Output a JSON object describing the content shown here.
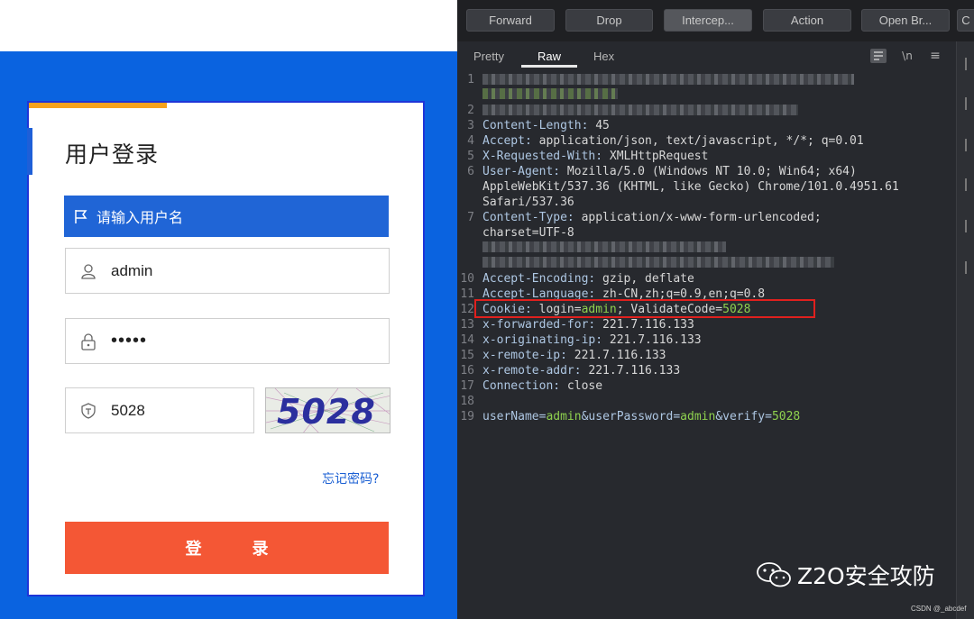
{
  "login": {
    "title": "用户登录",
    "notice": "请输入用户名",
    "username_value": "admin",
    "password_value": "•••••",
    "code_value": "5028",
    "captcha_text": "5028",
    "forgot_link": "忘记密码?",
    "login_button": "登录"
  },
  "toolbar": {
    "forward": "Forward",
    "drop": "Drop",
    "intercept": "Intercep...",
    "action": "Action",
    "open_browser": "Open Br...",
    "more": "C"
  },
  "tabs": {
    "pretty": "Pretty",
    "raw": "Raw",
    "hex": "Hex",
    "newline": "\\n",
    "menu": "≡"
  },
  "request": {
    "lines": [
      {
        "n": "1",
        "key": "",
        "rest": ""
      },
      {
        "n": "2",
        "key": "",
        "rest": ""
      },
      {
        "n": "3",
        "key": "Content-Length:",
        "rest": " 45"
      },
      {
        "n": "4",
        "key": "Accept:",
        "rest": " application/json, text/javascript, */*; q=0.01"
      },
      {
        "n": "5",
        "key": "X-Requested-With:",
        "rest": " XMLHttpRequest"
      },
      {
        "n": "6",
        "key": "User-Agent:",
        "rest": " Mozilla/5.0 (Windows NT 10.0; Win64; x64)"
      },
      {
        "n": "",
        "key": "",
        "rest": "AppleWebKit/537.36 (KHTML, like Gecko) Chrome/101.0.4951.61"
      },
      {
        "n": "",
        "key": "",
        "rest": "Safari/537.36"
      },
      {
        "n": "7",
        "key": "Content-Type:",
        "rest": " application/x-www-form-urlencoded;"
      },
      {
        "n": "",
        "key": "",
        "rest": "charset=UTF-8"
      },
      {
        "n": "10",
        "key": "Accept-Encoding:",
        "rest": " gzip, deflate"
      },
      {
        "n": "11",
        "key": "Accept-Language:",
        "rest": " zh-CN,zh;q=0.9,en;q=0.8"
      },
      {
        "n": "12",
        "key": "Cookie:",
        "rest": ""
      },
      {
        "n": "13",
        "key": "x-forwarded-for:",
        "rest": " 221.7.116.133"
      },
      {
        "n": "14",
        "key": "x-originating-ip:",
        "rest": " 221.7.116.133"
      },
      {
        "n": "15",
        "key": "x-remote-ip:",
        "rest": " 221.7.116.133"
      },
      {
        "n": "16",
        "key": "x-remote-addr:",
        "rest": " 221.7.116.133"
      },
      {
        "n": "17",
        "key": "Connection:",
        "rest": " close"
      },
      {
        "n": "18",
        "key": "",
        "rest": ""
      },
      {
        "n": "19",
        "key": "",
        "rest": ""
      }
    ],
    "cookie": {
      "login_key": " login=",
      "login_val": "admin",
      "sep": "; ValidateCode=",
      "code_val": "5028"
    },
    "body": {
      "k1": "userName=",
      "v1": "admin",
      "k2": "&userPassword=",
      "v2": "admin",
      "k3": "&verify=",
      "v3": "5028"
    }
  },
  "watermark": {
    "brand": "Z2O安全攻防",
    "csdn": "CSDN @_abcdef"
  }
}
